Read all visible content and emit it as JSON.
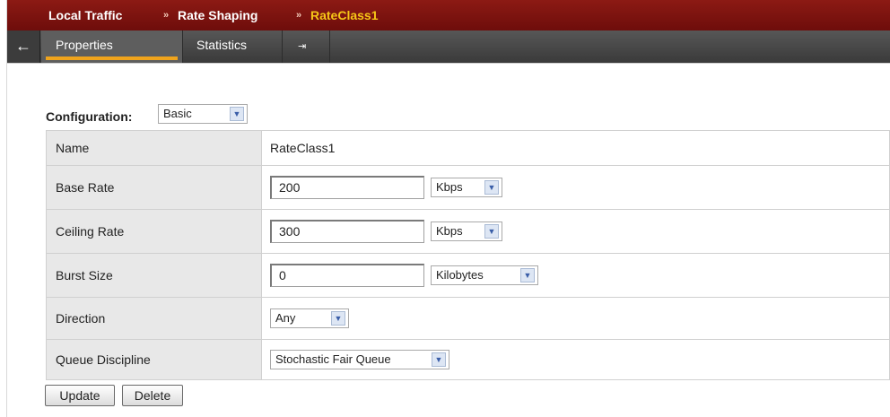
{
  "breadcrumb": {
    "items": [
      "Local Traffic",
      "Rate Shaping",
      "RateClass1"
    ],
    "separator": "»"
  },
  "tabs": {
    "back_icon": "←",
    "items": [
      "Properties",
      "Statistics"
    ],
    "export_icon": "⇥"
  },
  "configuration": {
    "label": "Configuration:",
    "value": "Basic"
  },
  "properties": {
    "name": {
      "label": "Name",
      "value": "RateClass1"
    },
    "base_rate": {
      "label": "Base Rate",
      "value": "200",
      "unit": "Kbps"
    },
    "ceiling_rate": {
      "label": "Ceiling Rate",
      "value": "300",
      "unit": "Kbps"
    },
    "burst_size": {
      "label": "Burst Size",
      "value": "0",
      "unit": "Kilobytes"
    },
    "direction": {
      "label": "Direction",
      "value": "Any"
    },
    "queue_discipline": {
      "label": "Queue Discipline",
      "value": "Stochastic Fair Queue"
    }
  },
  "buttons": {
    "update": "Update",
    "delete": "Delete"
  },
  "colors": {
    "breadcrumb_bg": "#7a0f0f",
    "current_crumb": "#f6c617",
    "tab_bar_bg": "#4a4a4a",
    "active_tab_underline": "#f0a41c",
    "label_cell_bg": "#e8e8e8"
  },
  "icons": {
    "back": "arrow-left-icon",
    "export": "export-icon",
    "dropdown": "chevron-down-icon"
  }
}
